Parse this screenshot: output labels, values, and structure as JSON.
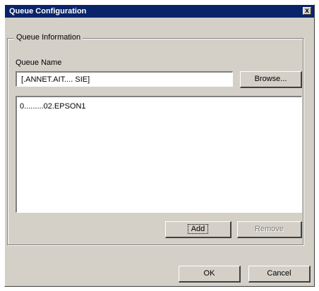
{
  "window": {
    "title": "Queue Configuration",
    "close_glyph": "x"
  },
  "group": {
    "legend": "Queue Information"
  },
  "queue_name": {
    "label": "Queue Name",
    "value": "[.ANNET.AIT.... SIE]"
  },
  "buttons": {
    "browse": "Browse...",
    "add": "Add",
    "remove": "Remove",
    "ok": "OK",
    "cancel": "Cancel"
  },
  "list": {
    "items": [
      "0.........02.EPSON1"
    ]
  }
}
